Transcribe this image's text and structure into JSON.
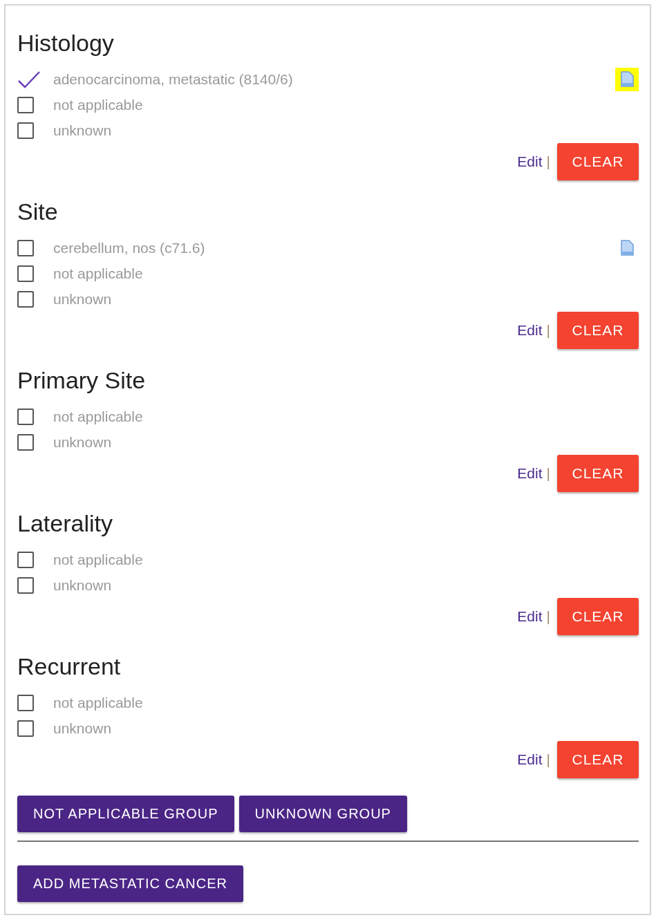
{
  "sections": [
    {
      "title": "Histology",
      "options": [
        {
          "label": "adenocarcinoma, metastatic (8140/6)",
          "checked": true,
          "note": {
            "highlighted": true
          }
        },
        {
          "label": "not applicable",
          "checked": false
        },
        {
          "label": "unknown",
          "checked": false
        }
      ],
      "edit_link": "Edit",
      "separator": "|",
      "clear_button": "CLEAR"
    },
    {
      "title": "Site",
      "options": [
        {
          "label": "cerebellum, nos (c71.6)",
          "checked": false,
          "note": {
            "highlighted": false
          }
        },
        {
          "label": "not applicable",
          "checked": false
        },
        {
          "label": "unknown",
          "checked": false
        }
      ],
      "edit_link": "Edit",
      "separator": "|",
      "clear_button": "CLEAR"
    },
    {
      "title": "Primary Site",
      "options": [
        {
          "label": "not applicable",
          "checked": false
        },
        {
          "label": "unknown",
          "checked": false
        }
      ],
      "edit_link": "Edit",
      "separator": "|",
      "clear_button": "CLEAR"
    },
    {
      "title": "Laterality",
      "options": [
        {
          "label": "not applicable",
          "checked": false
        },
        {
          "label": "unknown",
          "checked": false
        }
      ],
      "edit_link": "Edit",
      "separator": "|",
      "clear_button": "CLEAR"
    },
    {
      "title": "Recurrent",
      "options": [
        {
          "label": "not applicable",
          "checked": false
        },
        {
          "label": "unknown",
          "checked": false
        }
      ],
      "edit_link": "Edit",
      "separator": "|",
      "clear_button": "CLEAR"
    }
  ],
  "group_buttons": [
    "NOT APPLICABLE GROUP",
    "UNKNOWN GROUP"
  ],
  "add_button": "ADD METASTATIC CANCER"
}
